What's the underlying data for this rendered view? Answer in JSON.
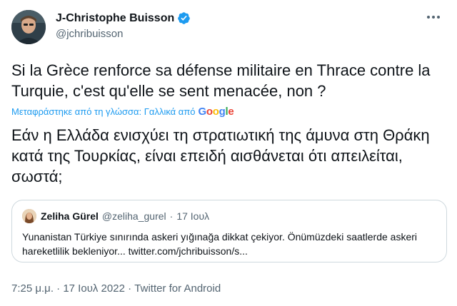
{
  "author": {
    "display_name": "J-Christophe Buisson",
    "handle": "@jchribuisson"
  },
  "icons": {
    "verified": "verified-badge-icon",
    "more": "more-options-icon"
  },
  "tweet": {
    "text": "Si la Grèce renforce sa défense militaire en Thrace contre la Turquie, c'est qu'elle se sent menacée, non ?",
    "translated_label": "Μεταφράστηκε από τη γλώσσα: Γαλλικά από",
    "translator": "Google",
    "translation": "Εάν η Ελλάδα ενισχύει τη στρατιωτική της άμυνα στη Θράκη κατά της Τουρκίας, είναι επειδή αισθάνεται ότι απειλείται, σωστά;"
  },
  "quote": {
    "name": "Zeliha Gürel",
    "handle": "@zeliha_gurel",
    "dot": "·",
    "date": "17 Ιουλ",
    "text": "Yunanistan Türkiye sınırında askeri yığınağa dikkat çekiyor. Önümüzdeki saatlerde askeri hareketlilik bekleniyor... twitter.com/jchribuisson/s..."
  },
  "meta": {
    "time": "7:25 μ.μ.",
    "sep1": " · ",
    "date": "17 Ιουλ 2022",
    "sep2": " · ",
    "source": "Twitter for Android"
  },
  "colors": {
    "accent": "#1d9bf0",
    "secondary_text": "#536471",
    "border": "#cfd9de"
  }
}
